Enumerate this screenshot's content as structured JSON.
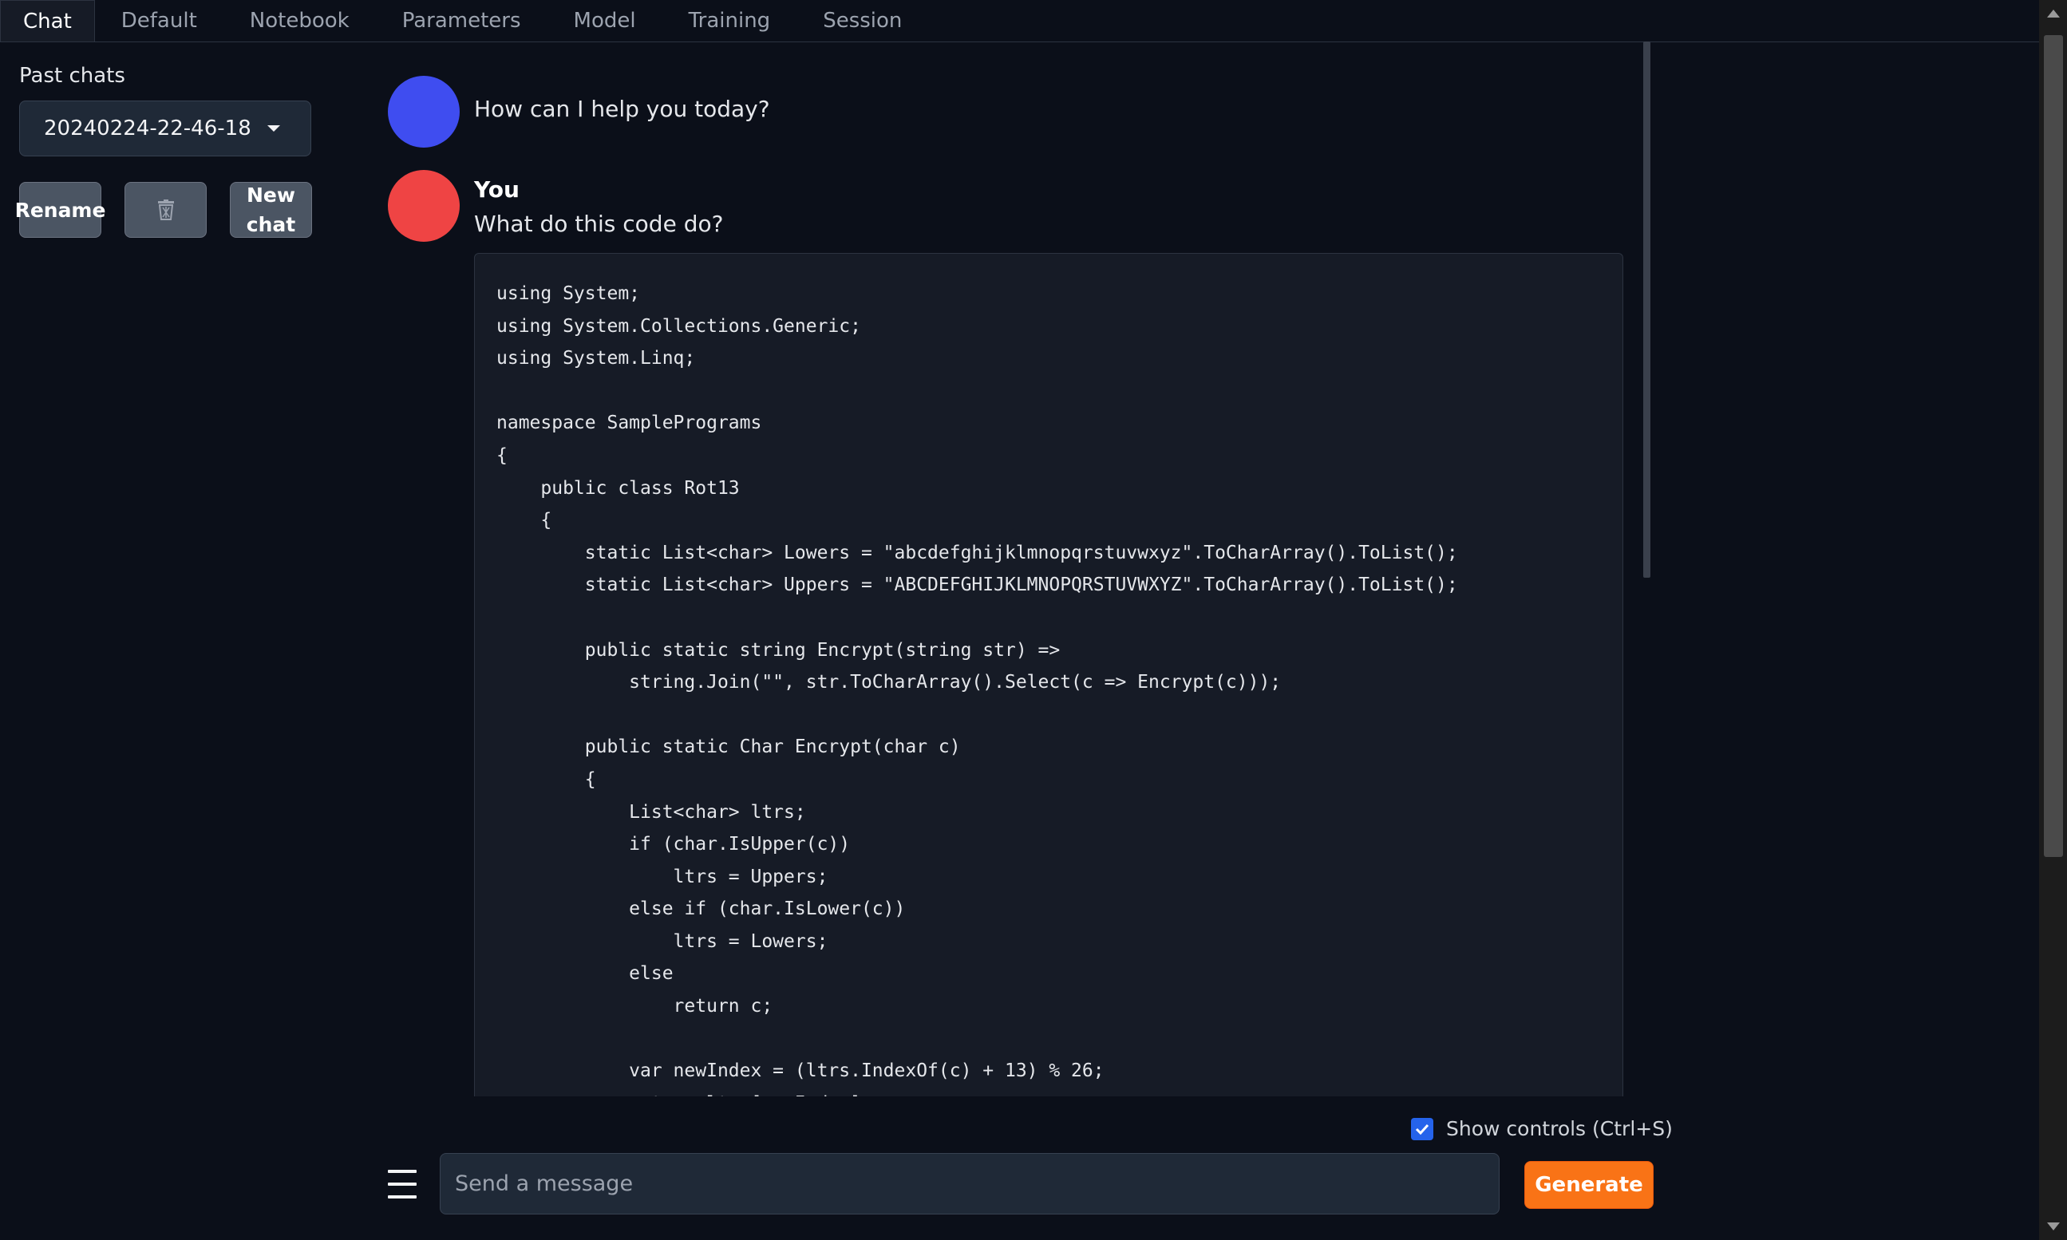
{
  "tabs": [
    "Chat",
    "Default",
    "Notebook",
    "Parameters",
    "Model",
    "Training",
    "Session"
  ],
  "sidebar": {
    "past_chats_label": "Past chats",
    "selected_chat": "20240224-22-46-18",
    "rename_label": "Rename",
    "new_chat_line1": "New",
    "new_chat_line2": "chat",
    "delete_icon": "trash-icon"
  },
  "messages": {
    "bot_text": "How can I help you today?",
    "user_name": "You",
    "user_text": "What do this code do?",
    "code": "using System;\nusing System.Collections.Generic;\nusing System.Linq;\n\nnamespace SamplePrograms\n{\n    public class Rot13\n    {\n        static List<char> Lowers = \"abcdefghijklmnopqrstuvwxyz\".ToCharArray().ToList();\n        static List<char> Uppers = \"ABCDEFGHIJKLMNOPQRSTUVWXYZ\".ToCharArray().ToList();\n\n        public static string Encrypt(string str) =>\n            string.Join(\"\", str.ToCharArray().Select(c => Encrypt(c)));\n\n        public static Char Encrypt(char c)\n        {\n            List<char> ltrs;\n            if (char.IsUpper(c))\n                ltrs = Uppers;\n            else if (char.IsLower(c))\n                ltrs = Lowers;\n            else\n                return c;\n\n            var newIndex = (ltrs.IndexOf(c) + 13) % 26;\n            return ltrs[newIndex];"
  },
  "controls": {
    "show_controls_label": "Show controls (Ctrl+S)",
    "show_controls_checked": true,
    "input_placeholder": "Send a message",
    "generate_label": "Generate"
  },
  "colors": {
    "bot_avatar": "#3f4df0",
    "user_avatar": "#ef4444",
    "accent": "#f97316",
    "background": "#0b0f19"
  }
}
